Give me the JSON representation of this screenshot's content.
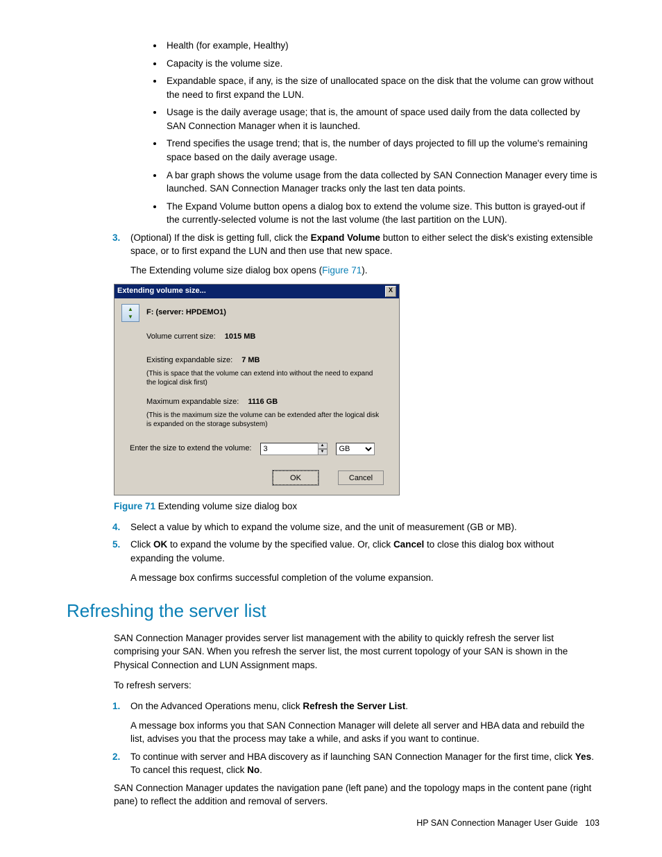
{
  "bullets": [
    "Health (for example, Healthy)",
    "Capacity is the volume size.",
    "Expandable space, if any, is the size of unallocated space on the disk that the volume can grow without the need to first expand the LUN.",
    "Usage is the daily average usage; that is, the amount of space used daily from the data collected by SAN Connection Manager when it is launched.",
    "Trend specifies the usage trend; that is, the number of days projected to fill up the volume's remaining space based on the daily average usage.",
    "A bar graph shows the volume usage from the data collected by SAN Connection Manager every time is launched. SAN Connection Manager tracks only the last ten data points.",
    "The Expand Volume button opens a dialog box to extend the volume size. This button is grayed-out if the currently-selected volume is not the last volume (the last partition on the LUN)."
  ],
  "step3": {
    "num": "3.",
    "pre": "(Optional) If the disk is getting full, click the ",
    "bold": "Expand Volume",
    "post": " button to either select the disk's existing extensible space, or to first expand the LUN and then use that new space.",
    "para2_pre": "The Extending volume size dialog box opens (",
    "para2_link": "Figure 71",
    "para2_post": ")."
  },
  "dialog": {
    "title": "Extending volume size...",
    "close": "X",
    "server": "F: (server: HPDEMO1)",
    "cur_label": "Volume current size:",
    "cur_value": "1015 MB",
    "exp_label": "Existing expandable size:",
    "exp_value": "7 MB",
    "exp_help": "(This is space that the volume can extend into without the need to expand the logical disk first)",
    "max_label": "Maximum expandable size:",
    "max_value": "1116 GB",
    "max_help": "(This is the maximum size the volume can be extended after the logical disk is expanded on the storage subsystem)",
    "input_label": "Enter the size to extend the volume:",
    "input_value": "3",
    "unit": "GB",
    "ok": "OK",
    "cancel": "Cancel"
  },
  "fig": {
    "label": "Figure 71",
    "caption": " Extending volume size dialog box"
  },
  "step4": {
    "num": "4.",
    "text": "Select a value by which to expand the volume size, and the unit of measurement (GB or MB)."
  },
  "step5": {
    "num": "5.",
    "t1": "Click ",
    "b1": "OK",
    "t2": " to expand the volume by the specified value. Or, click ",
    "b2": "Cancel",
    "t3": " to close this dialog box without expanding the volume.",
    "para2": "A message box confirms successful completion of the volume expansion."
  },
  "section_heading": "Refreshing the server list",
  "p1": "SAN Connection Manager provides server list management with the ability to quickly refresh the server list comprising your SAN. When you refresh the server list, the most current topology of your SAN is shown in the Physical Connection and LUN Assignment maps.",
  "p2": "To refresh servers:",
  "r_step1": {
    "num": "1.",
    "t1": "On the Advanced Operations menu, click ",
    "b1": "Refresh the Server List",
    "t2": ".",
    "para2": "A message box informs you that SAN Connection Manager will delete all server and HBA data and rebuild the list, advises you that the process may take a while, and asks if you want to continue."
  },
  "r_step2": {
    "num": "2.",
    "t1": "To continue with server and HBA discovery as if launching SAN Connection Manager for the first time, click ",
    "b1": "Yes",
    "t2": ". To cancel this request, click ",
    "b2": "No",
    "t3": "."
  },
  "p3": "SAN Connection Manager updates the navigation pane (left pane) and the topology maps in the content pane (right pane) to reflect the addition and removal of servers.",
  "footer": {
    "text": "HP SAN Connection Manager User Guide",
    "page": "103"
  }
}
